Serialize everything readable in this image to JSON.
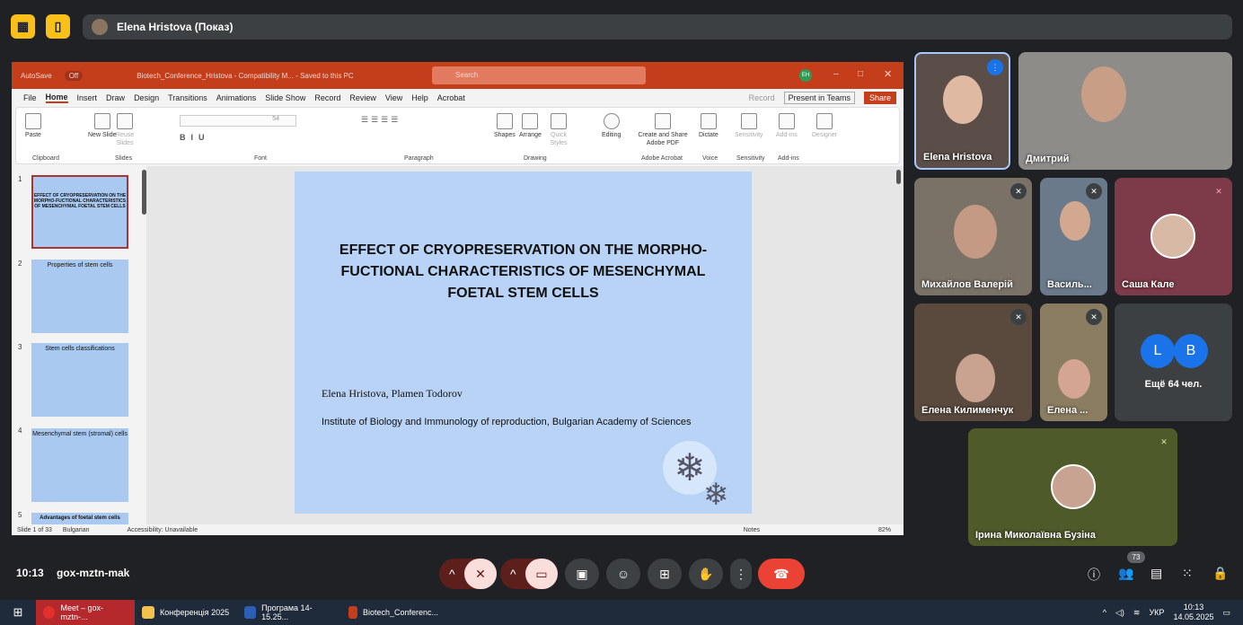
{
  "top_bar": {
    "presenter_label": "Elena Hristova (Показ)"
  },
  "ppt": {
    "autosave": "AutoSave",
    "autosave_state": "Off",
    "title": "Biotech_Conference_Hristova  -  Compatibility M...  -  Saved to this PC",
    "search_placeholder": "Search",
    "user_initials": "EH",
    "menu": [
      "File",
      "Home",
      "Insert",
      "Draw",
      "Design",
      "Transitions",
      "Animations",
      "Slide Show",
      "Record",
      "Review",
      "View",
      "Help",
      "Acrobat"
    ],
    "record": "Record",
    "present_teams": "Present in Teams",
    "share": "Share",
    "ribbon": {
      "paste": "Paste",
      "clipboard": "Clipboard",
      "new_slide": "New Slide",
      "reuse_slides": "Reuse Slides",
      "slides": "Slides",
      "font_size": "54",
      "font": "Font",
      "paragraph": "Paragraph",
      "shapes": "Shapes",
      "arrange": "Arrange",
      "quick_styles": "Quick Styles",
      "drawing": "Drawing",
      "editing": "Editing",
      "create_share": "Create and Share Adobe PDF",
      "adobe_acrobat": "Adobe Acrobat",
      "dictate": "Dictate",
      "voice": "Voice",
      "sensitivity": "Sensitivity",
      "addins": "Add-ins",
      "designer": "Designer"
    },
    "thumbs": [
      {
        "n": "1",
        "title": "EFFECT OF CRYOPRESERVATION ON THE MORPHO-FUCTIONAL CHARACTERISTICS OF MESENCHYMAL FOETAL STEM CELLS"
      },
      {
        "n": "2",
        "title": "Properties of stem cells"
      },
      {
        "n": "3",
        "title": "Stem cells classifications"
      },
      {
        "n": "4",
        "title": "Mesenchymal stem (stromal) cells"
      },
      {
        "n": "5",
        "title": "Advantages of foetal stem cells"
      }
    ],
    "slide": {
      "title": "EFFECT OF CRYOPRESERVATION ON THE MORPHO-FUCTIONAL CHARACTERISTICS OF MESENCHYMAL FOETAL STEM CELLS",
      "authors": "Elena Hristova, Plamen Todorov",
      "institute": "Institute of Biology and Immunology of reproduction, Bulgarian Academy of Sciences"
    },
    "status": {
      "slide_of": "Slide 1 of 33",
      "language": "Bulgarian",
      "accessibility": "Accessibility: Unavailable",
      "notes": "Notes",
      "zoom": "82%"
    }
  },
  "participants": [
    {
      "name": "Elena Hristova"
    },
    {
      "name": "Дмитрий"
    },
    {
      "name": "Михайлов Валерій"
    },
    {
      "name": "Василь..."
    },
    {
      "name": "Саша Кале"
    },
    {
      "name": "Елена Килименчук"
    },
    {
      "name": "Елена ..."
    },
    {
      "name": "Ірина Миколаївна Бузіна"
    }
  ],
  "more": {
    "a": "L",
    "b": "B",
    "label": "Ещё 64 чел."
  },
  "bottom": {
    "time": "10:13",
    "meeting_code": "gox-mztn-mak",
    "people_count": "73"
  },
  "taskbar": {
    "items": [
      "Meet – gox-mztn-...",
      "Конференція 2025",
      "Програма 14-15.25...",
      "Biotech_Conferenc..."
    ],
    "lang": "УКР",
    "clock_time": "10:13",
    "clock_date": "14.05.2025"
  },
  "colors": {
    "ppt_red": "#c43e1c",
    "meet_bg": "#202124",
    "hangup": "#ea4335"
  }
}
